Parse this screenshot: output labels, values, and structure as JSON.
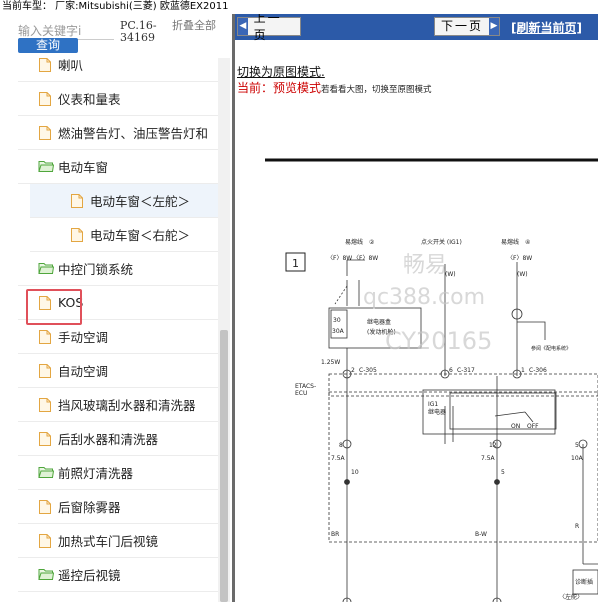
{
  "topbar": {
    "text": "当前车型： 厂家:Mitsubishi(三菱) 欧蓝德EX2011"
  },
  "search": {
    "placeholder": "输入关键字i",
    "button_label": "查询",
    "code": "PC.16-34169",
    "collapse_label": "折叠全部"
  },
  "tree": [
    {
      "label": "喇叭",
      "icon": "file-icon",
      "level": 1
    },
    {
      "label": "仪表和量表",
      "icon": "file-icon",
      "level": 1
    },
    {
      "label": "燃油警告灯、油压警告灯和",
      "icon": "file-icon",
      "level": 1
    },
    {
      "label": "电动车窗",
      "icon": "folder-open-icon",
      "level": 1
    },
    {
      "label": "电动车窗＜左舵＞",
      "icon": "file-icon",
      "level": 2
    },
    {
      "label": "电动车窗＜右舵＞",
      "icon": "file-icon",
      "level": 2
    },
    {
      "label": "中控门锁系统",
      "icon": "folder-open-icon",
      "level": 1
    },
    {
      "label": "KOS",
      "icon": "file-icon",
      "level": 1
    },
    {
      "label": "手动空调",
      "icon": "file-icon",
      "level": 1
    },
    {
      "label": "自动空调",
      "icon": "file-icon",
      "level": 1
    },
    {
      "label": "挡风玻璃刮水器和清洗器",
      "icon": "file-icon",
      "level": 1
    },
    {
      "label": "后刮水器和清洗器",
      "icon": "file-icon",
      "level": 1
    },
    {
      "label": "前照灯清洗器",
      "icon": "folder-open-icon",
      "level": 1
    },
    {
      "label": "后窗除雾器",
      "icon": "file-icon",
      "level": 1
    },
    {
      "label": "加热式车门后视镜",
      "icon": "file-icon",
      "level": 1
    },
    {
      "label": "遥控后视镜",
      "icon": "folder-open-icon",
      "level": 1
    }
  ],
  "nav": {
    "prev_label": "上一页",
    "next_label": "下一页",
    "refresh_label": "[刷新当前页]"
  },
  "view": {
    "switch_link": "切换为原图模式.",
    "mode_label": "当前：预览模式",
    "mode_hint": "若看看大图，切换至原图模式"
  },
  "diagram": {
    "frame_number": "1",
    "fuse_label_1": "易熔线",
    "fuse_num_1": "②",
    "fuse_label_2": "易熔线",
    "fuse_num_2": "④",
    "ignition_label": "点火开关 (IG1)",
    "fb_1": "〈F〉8W",
    "fb_2": "〈F〉8W",
    "fb_3": "〈F〉8W",
    "w_1": "(W)",
    "w_2": "(W)",
    "relay_box_num": "30",
    "relay_box_amp": "30A",
    "relay_box_text_1": "继电器盒",
    "relay_box_text_2": "(发动机舱)",
    "ref_note": "参阅《配电系统》",
    "wire_1": "1.25W",
    "conn_1_pin": "2",
    "conn_1": "C-305",
    "conn_2_pin": "6",
    "conn_2": "C-317",
    "conn_3_pin": "1",
    "conn_3": "C-306",
    "ecu_label_1": "ETACS-",
    "ecu_label_2": "ECU",
    "ig1_relay_1": "IG1",
    "ig1_relay_2": "继电器",
    "on_label": "ON",
    "off_label": "OFF",
    "fuse_8": "8",
    "fuse_12": "12",
    "fuse_5": "5",
    "amp_1": "7.5A",
    "amp_2": "7.5A",
    "amp_3": "10A",
    "pin_10": "10",
    "pin_5": "5",
    "wire_br": "BR",
    "wire_bw": "B-W",
    "wire_r": "R",
    "diag_note": "诊断插",
    "bottom_note": "〈左舵〉",
    "watermark_1": "畅易",
    "watermark_2": "qc388.com",
    "watermark_3": "CY20165"
  },
  "colors": {
    "nav_blue": "#2c5aa8",
    "button_blue": "#2f72c4",
    "highlight_red": "#e0505a",
    "mode_red": "#cc0000"
  }
}
